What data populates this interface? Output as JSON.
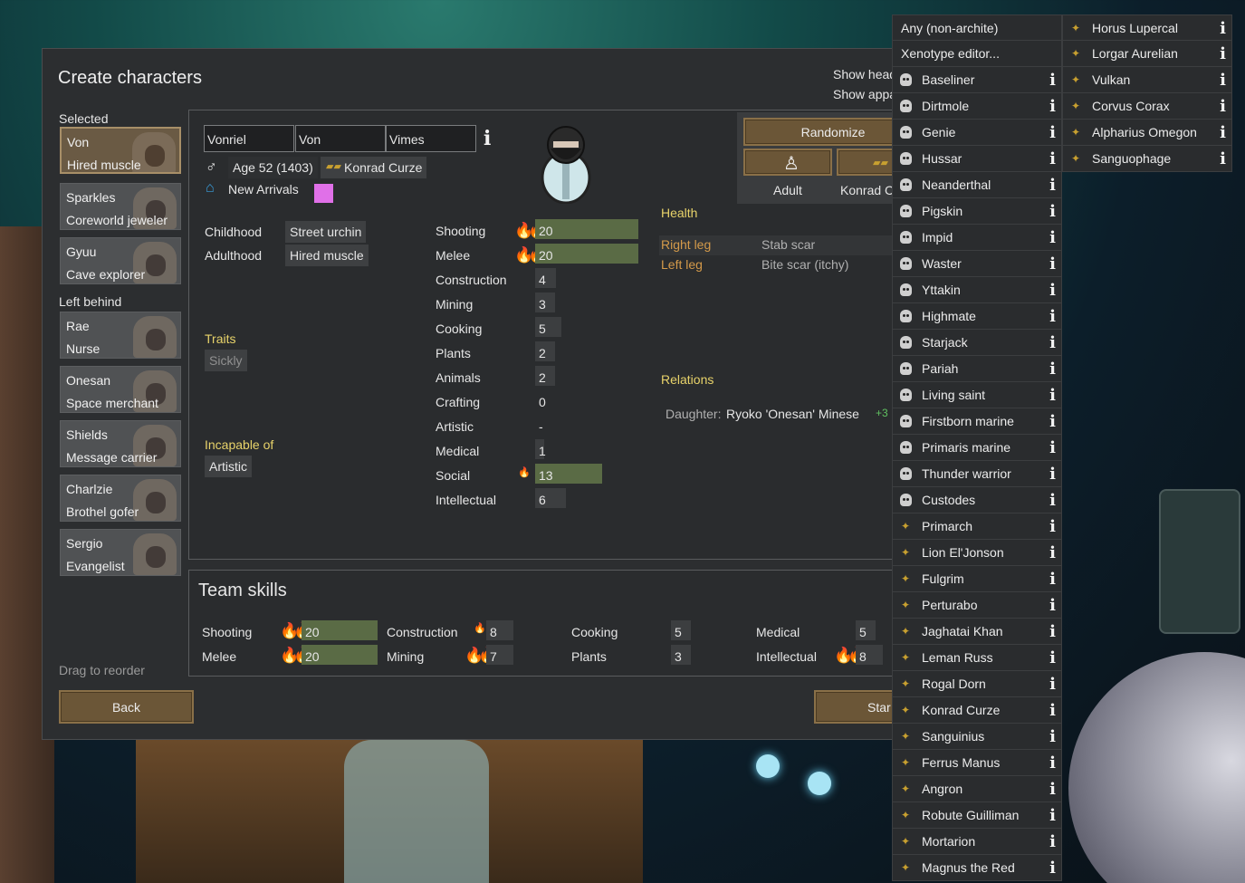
{
  "window": {
    "title": "Create characters",
    "show_head": "Show head",
    "show_apparel": "Show appa"
  },
  "left": {
    "selected_label": "Selected",
    "left_behind_label": "Left behind",
    "drag_hint": "Drag to reorder",
    "back_label": "Back",
    "selected": [
      {
        "name": "Von",
        "title": "Hired muscle"
      },
      {
        "name": "Sparkles",
        "title": "Coreworld jeweler"
      },
      {
        "name": "Gyuu",
        "title": "Cave explorer"
      }
    ],
    "left_behind": [
      {
        "name": "Rae",
        "title": "Nurse"
      },
      {
        "name": "Onesan",
        "title": "Space merchant"
      },
      {
        "name": "Shields",
        "title": "Message carrier"
      },
      {
        "name": "Charlzie",
        "title": "Brothel gofer"
      },
      {
        "name": "Sergio",
        "title": "Evangelist"
      }
    ]
  },
  "pawn": {
    "first": "Vonriel",
    "nick": "Von",
    "last": "Vimes",
    "age": "Age 52 (1403)",
    "xenotype": "Konrad Curze",
    "faction": "New Arrivals",
    "favorite_color": "#e070e8",
    "childhood_label": "Childhood",
    "childhood": "Street urchin",
    "adulthood_label": "Adulthood",
    "adulthood": "Hired muscle",
    "traits_label": "Traits",
    "trait": "Sickly",
    "incapable_label": "Incapable of",
    "incapable": "Artistic",
    "randomize": "Randomize",
    "dev_stage": "Adult",
    "xeno_btn": "Konrad C",
    "health_label": "Health",
    "health": [
      {
        "part": "Right leg",
        "condition": "Stab scar"
      },
      {
        "part": "Left leg",
        "condition": "Bite scar (itchy)"
      }
    ],
    "relations_label": "Relations",
    "relation": {
      "kind": "Daughter:",
      "name": "Ryoko 'Onesan' Minese",
      "opinion": "+3"
    },
    "start": "Star"
  },
  "skills": [
    {
      "name": "Shooting",
      "value": "20",
      "level": 20,
      "passion": "major"
    },
    {
      "name": "Melee",
      "value": "20",
      "level": 20,
      "passion": "major"
    },
    {
      "name": "Construction",
      "value": "4",
      "level": 4,
      "passion": "none"
    },
    {
      "name": "Mining",
      "value": "3",
      "level": 3,
      "passion": "none"
    },
    {
      "name": "Cooking",
      "value": "5",
      "level": 5,
      "passion": "none"
    },
    {
      "name": "Plants",
      "value": "2",
      "level": 2,
      "passion": "none"
    },
    {
      "name": "Animals",
      "value": "2",
      "level": 2,
      "passion": "none"
    },
    {
      "name": "Crafting",
      "value": "0",
      "level": 0,
      "passion": "none"
    },
    {
      "name": "Artistic",
      "value": "-",
      "level": 0,
      "passion": "none"
    },
    {
      "name": "Medical",
      "value": "1",
      "level": 1,
      "passion": "none"
    },
    {
      "name": "Social",
      "value": "13",
      "level": 13,
      "passion": "minor"
    },
    {
      "name": "Intellectual",
      "value": "6",
      "level": 6,
      "passion": "none"
    }
  ],
  "team": {
    "title": "Team skills",
    "skills": [
      {
        "name": "Shooting",
        "value": "20",
        "level": 20,
        "passion": "major"
      },
      {
        "name": "Melee",
        "value": "20",
        "level": 20,
        "passion": "major"
      },
      {
        "name": "Construction",
        "value": "8",
        "level": 8,
        "passion": "minor"
      },
      {
        "name": "Mining",
        "value": "7",
        "level": 7,
        "passion": "major"
      },
      {
        "name": "Cooking",
        "value": "5",
        "level": 5,
        "passion": "none"
      },
      {
        "name": "Plants",
        "value": "3",
        "level": 3,
        "passion": "none"
      },
      {
        "name": "Medical",
        "value": "5",
        "level": 5,
        "passion": "none"
      },
      {
        "name": "Intellectual",
        "value": "8",
        "level": 8,
        "passion": "major"
      }
    ]
  },
  "xenotype_menu": {
    "col1": [
      "Any (non-archite)",
      "Xenotype editor...",
      "Baseliner",
      "Dirtmole",
      "Genie",
      "Hussar",
      "Neanderthal",
      "Pigskin",
      "Impid",
      "Waster",
      "Yttakin",
      "Highmate",
      "Starjack",
      "Pariah",
      "Living saint",
      "Firstborn marine",
      "Primaris marine",
      "Thunder warrior",
      "Custodes",
      "Primarch",
      "Lion El'Jonson",
      "Fulgrim",
      "Perturabo",
      "Jaghatai Khan",
      "Leman Russ",
      "Rogal Dorn",
      "Konrad Curze",
      "Sanguinius",
      "Ferrus Manus",
      "Angron",
      "Robute Guilliman",
      "Mortarion",
      "Magnus the Red"
    ],
    "col2": [
      "Horus Lupercal",
      "Lorgar Aurelian",
      "Vulkan",
      "Corvus Corax",
      "Alpharius Omegon",
      "Sanguophage"
    ]
  },
  "colors": {
    "accent_brown": "#6b5637",
    "skill_bar": "#5a6b45",
    "panel": "#2c2e30",
    "label_yellow": "#e8d36a",
    "health_orange": "#d49a4a"
  }
}
